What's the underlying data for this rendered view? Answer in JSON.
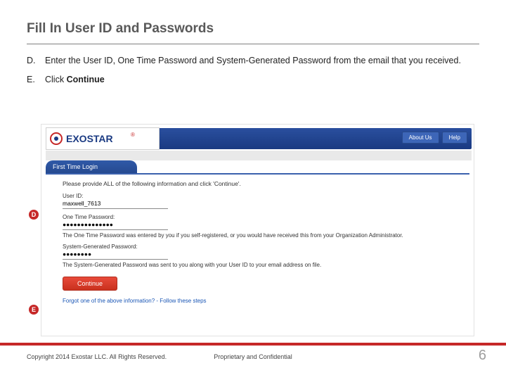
{
  "title": "Fill In User ID and Passwords",
  "steps": {
    "d_letter": "D.",
    "d_text": "Enter the User ID, One Time Password and System-Generated Password from the email that you received.",
    "e_letter": "E.",
    "e_prefix": "Click ",
    "e_bold": "Continue"
  },
  "shot": {
    "about": "About Us",
    "help": "Help",
    "logo_main": "EXOSTAR",
    "tab": "First Time Login",
    "intro": "Please provide ALL of the following information and click 'Continue'.",
    "userid_label": "User ID:",
    "userid_value": "maxwell_7613",
    "otp_label": "One Time Password:",
    "otp_value": "●●●●●●●●●●●●●●",
    "otp_hint": "The One Time Password was entered by you if you self-registered, or you would have received this from your Organization Administrator.",
    "sys_label": "System-Generated Password:",
    "sys_value": "●●●●●●●●",
    "sys_hint": "The System-Generated Password was sent to you along with your User ID to your email address on file.",
    "continue": "Continue",
    "forgot": "Forgot one of the above information? - Follow these steps"
  },
  "callouts": {
    "d": "D",
    "e": "E"
  },
  "footer": {
    "copyright": "Copyright 2014 Exostar LLC. All Rights Reserved.",
    "confidential": "Proprietary and Confidential",
    "page": "6"
  }
}
